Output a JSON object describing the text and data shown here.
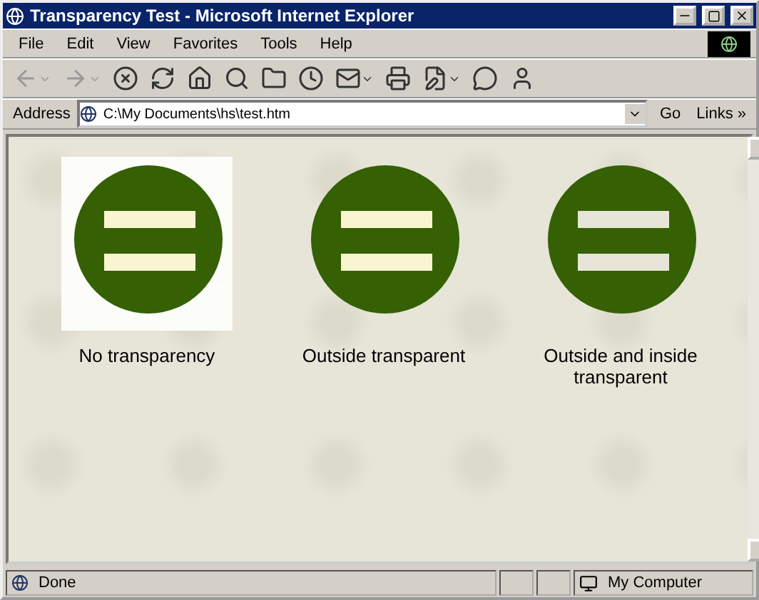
{
  "window": {
    "title": "Transparency Test - Microsoft Internet Explorer"
  },
  "menu": [
    "File",
    "Edit",
    "View",
    "Favorites",
    "Tools",
    "Help"
  ],
  "toolbar": [
    {
      "kind": "back",
      "disabled": true,
      "dropdown": true
    },
    {
      "kind": "forward",
      "disabled": true,
      "dropdown": true
    },
    {
      "kind": "stop",
      "disabled": false,
      "dropdown": false
    },
    {
      "kind": "refresh",
      "disabled": false,
      "dropdown": false
    },
    {
      "kind": "home",
      "disabled": false,
      "dropdown": false
    },
    {
      "kind": "search",
      "disabled": false,
      "dropdown": false
    },
    {
      "kind": "favorites",
      "disabled": false,
      "dropdown": false
    },
    {
      "kind": "history",
      "disabled": false,
      "dropdown": false
    },
    {
      "kind": "mail",
      "disabled": false,
      "dropdown": true
    },
    {
      "kind": "print",
      "disabled": false,
      "dropdown": false
    },
    {
      "kind": "edit",
      "disabled": false,
      "dropdown": true
    },
    {
      "kind": "discuss",
      "disabled": false,
      "dropdown": false
    },
    {
      "kind": "messenger",
      "disabled": false,
      "dropdown": false
    }
  ],
  "address": {
    "label": "Address",
    "value": "C:\\My Documents\\hs\\test.htm",
    "go": "Go",
    "links": "Links »"
  },
  "images": [
    {
      "kind": "none",
      "caption": "No transparency"
    },
    {
      "kind": "outside",
      "caption": "Outside transparent"
    },
    {
      "kind": "both",
      "caption": "Outside and inside transparent"
    }
  ],
  "status_bar": {
    "text": "Done",
    "zone": "My Computer"
  }
}
